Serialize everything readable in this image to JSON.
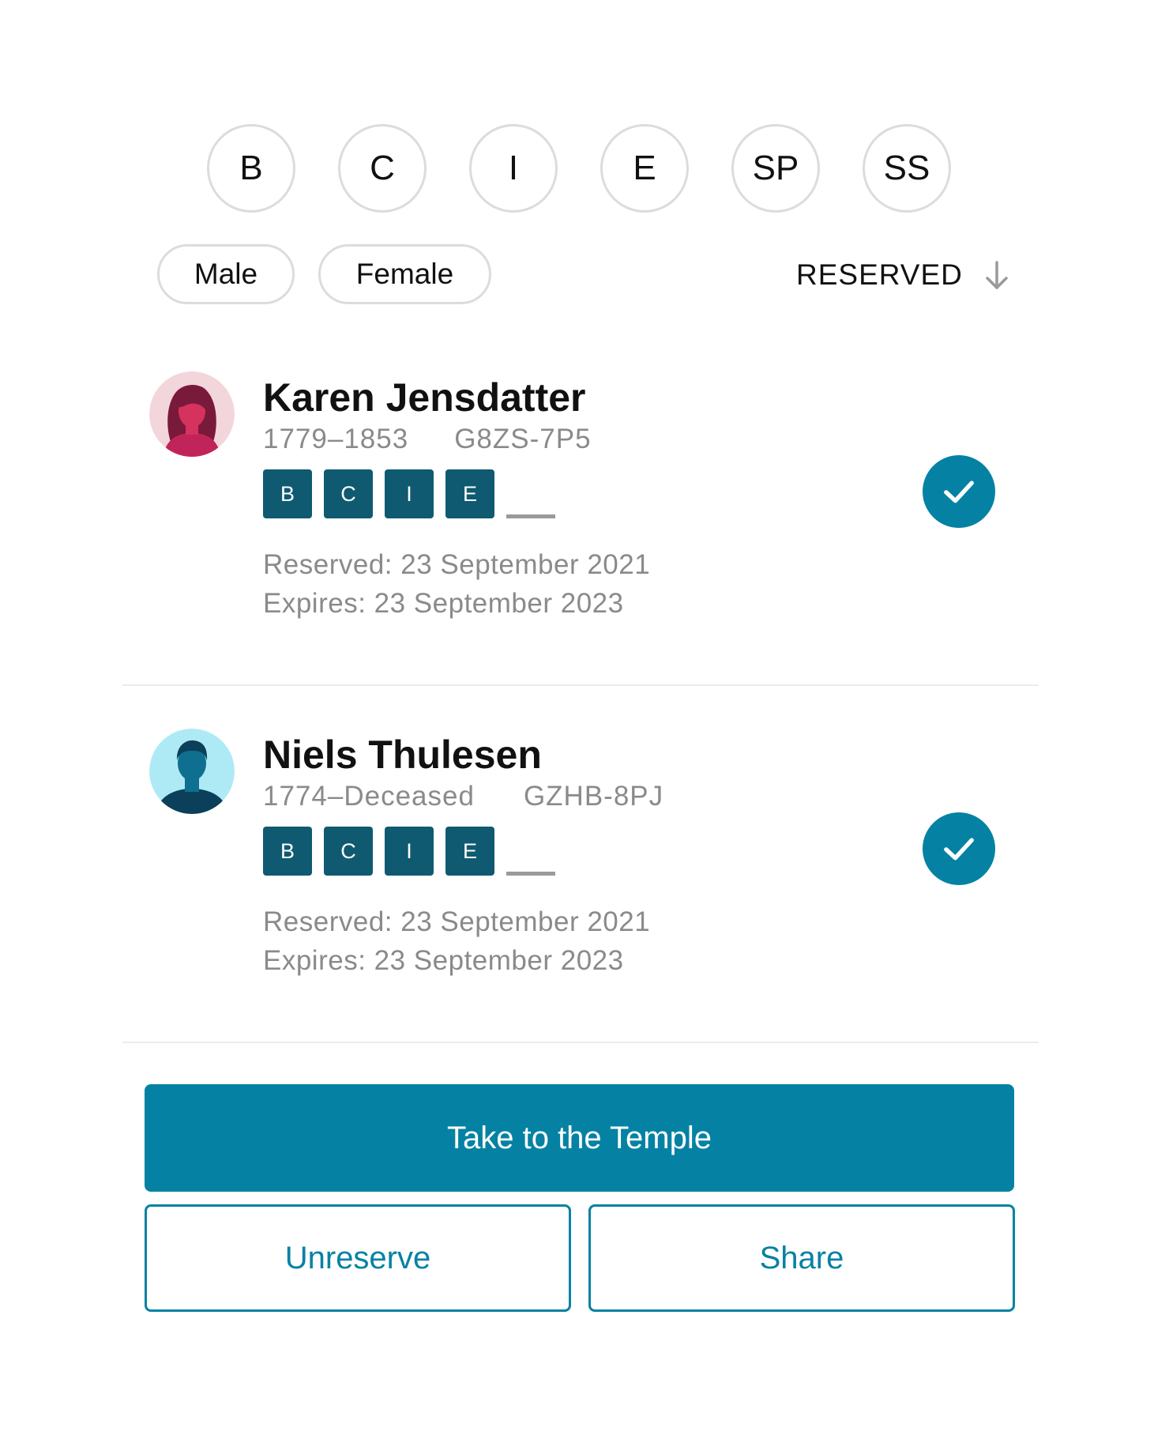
{
  "ordinance_filters": [
    "B",
    "C",
    "I",
    "E",
    "SP",
    "SS"
  ],
  "gender_filters": {
    "male": "Male",
    "female": "Female"
  },
  "sort": {
    "label": "RESERVED",
    "icon": "arrow-down-icon"
  },
  "people": [
    {
      "name": "Karen Jensdatter",
      "lifespan": "1779–1853",
      "pid": "G8ZS-7P5",
      "avatar": "female-avatar-icon",
      "ordinances": [
        "B",
        "C",
        "I",
        "E"
      ],
      "reserved": "Reserved: 23 September 2021",
      "expires": "Expires: 23 September 2023",
      "selected": true
    },
    {
      "name": "Niels Thulesen",
      "lifespan": "1774–Deceased",
      "pid": "GZHB-8PJ",
      "avatar": "male-avatar-icon",
      "ordinances": [
        "B",
        "C",
        "I",
        "E"
      ],
      "reserved": "Reserved: 23 September 2021",
      "expires": "Expires: 23 September 2023",
      "selected": true
    }
  ],
  "actions": {
    "primary": "Take to the Temple",
    "unreserve": "Unreserve",
    "share": "Share"
  },
  "colors": {
    "accent": "#0582a3",
    "ordinance_box": "#0f5a70",
    "female_avatar_bg": "#f3d6db",
    "male_avatar_bg": "#aeeaf5"
  }
}
